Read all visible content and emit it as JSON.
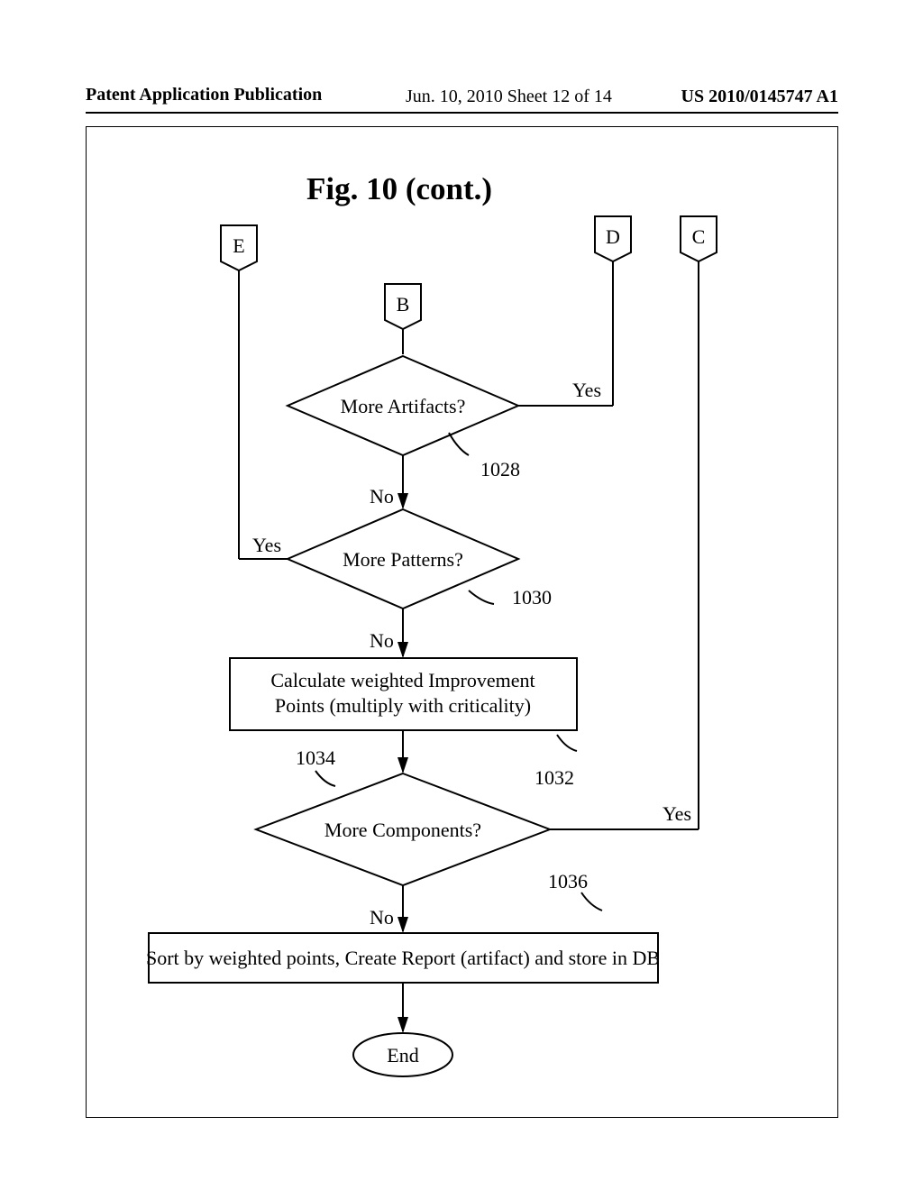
{
  "header": {
    "left": "Patent Application Publication",
    "mid": "Jun. 10, 2010  Sheet 12 of 14",
    "right": "US 2010/0145747 A1"
  },
  "title": "Fig. 10 (cont.)",
  "connectors": {
    "E": "E",
    "B": "B",
    "D": "D",
    "C": "C"
  },
  "decisions": {
    "artifacts": "More Artifacts?",
    "patterns": "More Patterns?",
    "components": "More Components?"
  },
  "processes": {
    "calc_line1": "Calculate weighted Improvement",
    "calc_line2": "Points (multiply with criticality)",
    "sort": "Sort by weighted points, Create Report (artifact) and store in DB"
  },
  "labels": {
    "yes": "Yes",
    "no": "No"
  },
  "refs": {
    "r1028": "1028",
    "r1030": "1030",
    "r1032": "1032",
    "r1034": "1034",
    "r1036": "1036"
  },
  "terminator": {
    "end": "End"
  },
  "chart_data": {
    "type": "flowchart",
    "title": "Fig. 10 (cont.)",
    "nodes": [
      {
        "id": "E",
        "type": "offpage-connector",
        "label": "E"
      },
      {
        "id": "B",
        "type": "offpage-connector",
        "label": "B"
      },
      {
        "id": "D",
        "type": "offpage-connector",
        "label": "D"
      },
      {
        "id": "C",
        "type": "offpage-connector",
        "label": "C"
      },
      {
        "id": "1028",
        "type": "decision",
        "label": "More Artifacts?",
        "ref": "1028"
      },
      {
        "id": "1030",
        "type": "decision",
        "label": "More Patterns?",
        "ref": "1030"
      },
      {
        "id": "1032",
        "type": "process",
        "label": "Calculate weighted Improvement Points (multiply with criticality)",
        "ref": "1032"
      },
      {
        "id": "1034",
        "type": "decision",
        "label": "More Components?",
        "ref": "1034"
      },
      {
        "id": "1036",
        "type": "process",
        "label": "Sort by weighted points, Create Report (artifact) and store in DB",
        "ref": "1036"
      },
      {
        "id": "end",
        "type": "terminator",
        "label": "End"
      }
    ],
    "edges": [
      {
        "from": "B",
        "to": "1028"
      },
      {
        "from": "1028",
        "to": "D",
        "label": "Yes"
      },
      {
        "from": "1028",
        "to": "1030",
        "label": "No"
      },
      {
        "from": "1030",
        "to": "E",
        "label": "Yes"
      },
      {
        "from": "1030",
        "to": "1032",
        "label": "No"
      },
      {
        "from": "1032",
        "to": "1034"
      },
      {
        "from": "1034",
        "to": "C",
        "label": "Yes"
      },
      {
        "from": "1034",
        "to": "1036",
        "label": "No"
      },
      {
        "from": "1036",
        "to": "end"
      }
    ]
  }
}
